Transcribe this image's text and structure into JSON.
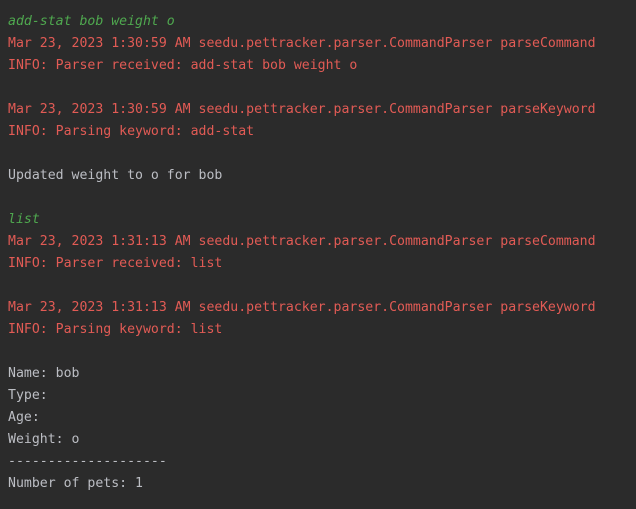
{
  "console": {
    "colors": {
      "background": "#2b2b2b",
      "user_input": "#4fa84f",
      "log_text": "#e25b55",
      "program_output": "#bcbec4"
    },
    "lines": [
      {
        "kind": "input",
        "text": "add-stat bob weight o"
      },
      {
        "kind": "log",
        "text": "Mar 23, 2023 1:30:59 AM seedu.pettracker.parser.CommandParser parseCommand"
      },
      {
        "kind": "log",
        "text": "INFO: Parser received: add-stat bob weight o"
      },
      {
        "kind": "blank",
        "text": ""
      },
      {
        "kind": "log",
        "text": "Mar 23, 2023 1:30:59 AM seedu.pettracker.parser.CommandParser parseKeyword"
      },
      {
        "kind": "log",
        "text": "INFO: Parsing keyword: add-stat"
      },
      {
        "kind": "blank",
        "text": ""
      },
      {
        "kind": "out",
        "text": "Updated weight to o for bob"
      },
      {
        "kind": "blank",
        "text": ""
      },
      {
        "kind": "input",
        "text": "list"
      },
      {
        "kind": "log",
        "text": "Mar 23, 2023 1:31:13 AM seedu.pettracker.parser.CommandParser parseCommand"
      },
      {
        "kind": "log",
        "text": "INFO: Parser received: list"
      },
      {
        "kind": "blank",
        "text": ""
      },
      {
        "kind": "log",
        "text": "Mar 23, 2023 1:31:13 AM seedu.pettracker.parser.CommandParser parseKeyword"
      },
      {
        "kind": "log",
        "text": "INFO: Parsing keyword: list"
      },
      {
        "kind": "blank",
        "text": ""
      },
      {
        "kind": "out",
        "text": "Name: bob"
      },
      {
        "kind": "out",
        "text": "Type:"
      },
      {
        "kind": "out",
        "text": "Age:"
      },
      {
        "kind": "out",
        "text": "Weight: o"
      },
      {
        "kind": "out",
        "text": "--------------------"
      },
      {
        "kind": "out",
        "text": "Number of pets: 1"
      }
    ]
  }
}
